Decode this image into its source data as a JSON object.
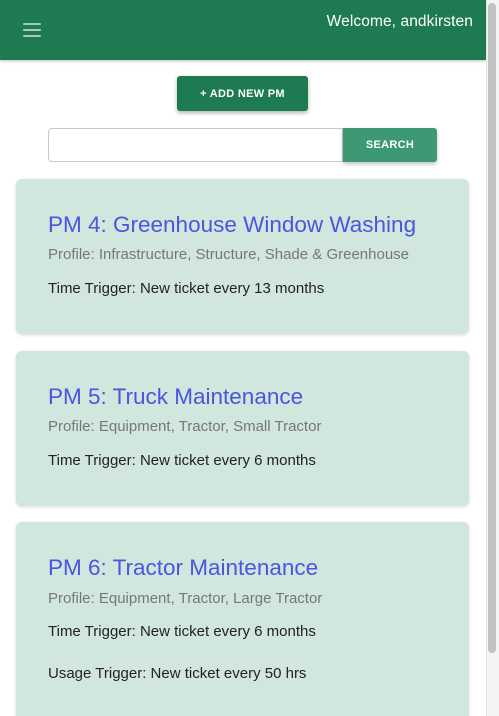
{
  "header": {
    "menu_icon": "hamburger-menu-icon",
    "welcome_text": "Welcome, andkirsten"
  },
  "toolbar": {
    "add_button_label": "+ ADD NEW PM"
  },
  "search": {
    "value": "",
    "placeholder": "",
    "button_label": "SEARCH"
  },
  "pm_list": [
    {
      "title": "PM 4: Greenhouse Window Washing",
      "profile": "Profile: Infrastructure, Structure, Shade & Greenhouse",
      "time_trigger": "Time Trigger: New ticket every 13 months"
    },
    {
      "title": "PM 5: Truck Maintenance",
      "profile": "Profile: Equipment, Tractor, Small Tractor",
      "time_trigger": "Time Trigger: New ticket every 6 months"
    },
    {
      "title": "PM 6: Tractor Maintenance",
      "profile": "Profile: Equipment, Tractor, Large Tractor",
      "time_trigger": "Time Trigger: New ticket every 6 months",
      "usage_trigger": "Usage Trigger: New ticket every 50 hrs"
    }
  ],
  "colors": {
    "header_bg": "#1e7a50",
    "card_bg": "#d1e6dc",
    "title_link": "#4a55e0",
    "search_button": "#3d9973"
  }
}
